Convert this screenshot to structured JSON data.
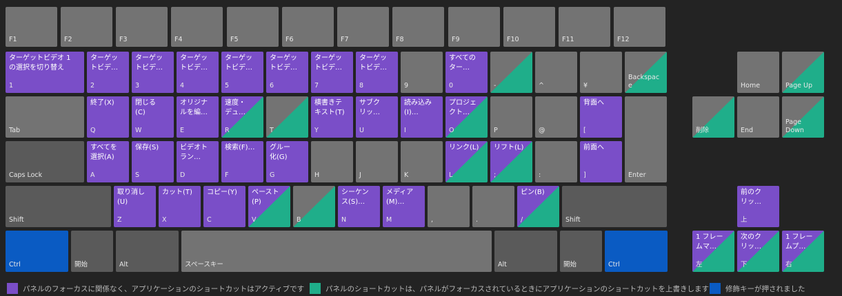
{
  "colors": {
    "background": "#232323",
    "key": "#737373",
    "modifier_key": "#5a5a5a",
    "global_shortcut": "#7a4ec8",
    "panel_shortcut": "#1fae8a",
    "modifier_pressed": "#0a5bc3"
  },
  "keys": [
    {
      "id": "f1",
      "cap": "F1",
      "style": "gray"
    },
    {
      "id": "f2",
      "cap": "F2",
      "style": "gray"
    },
    {
      "id": "f3",
      "cap": "F3",
      "style": "gray"
    },
    {
      "id": "f4",
      "cap": "F4",
      "style": "gray"
    },
    {
      "id": "f5",
      "cap": "F5",
      "style": "gray"
    },
    {
      "id": "f6",
      "cap": "F6",
      "style": "gray"
    },
    {
      "id": "f7",
      "cap": "F7",
      "style": "gray"
    },
    {
      "id": "f8",
      "cap": "F8",
      "style": "gray"
    },
    {
      "id": "f9",
      "cap": "F9",
      "style": "gray"
    },
    {
      "id": "f10",
      "cap": "F10",
      "style": "gray"
    },
    {
      "id": "f11",
      "cap": "F11",
      "style": "gray"
    },
    {
      "id": "f12",
      "cap": "F12",
      "style": "gray"
    },
    {
      "id": "1",
      "cap": "1",
      "action": "ターゲットビデオ 1\nの選択を切り替え",
      "style": "purple"
    },
    {
      "id": "2",
      "cap": "2",
      "action": "ターゲッ\nトビデ…",
      "style": "purple"
    },
    {
      "id": "3",
      "cap": "3",
      "action": "ターゲッ\nトビデ…",
      "style": "purple"
    },
    {
      "id": "4",
      "cap": "4",
      "action": "ターゲッ\nトビデ…",
      "style": "purple"
    },
    {
      "id": "5",
      "cap": "5",
      "action": "ターゲッ\nトビデ…",
      "style": "purple"
    },
    {
      "id": "6",
      "cap": "6",
      "action": "ターゲッ\nトビデ…",
      "style": "purple"
    },
    {
      "id": "7",
      "cap": "7",
      "action": "ターゲッ\nトビデ…",
      "style": "purple"
    },
    {
      "id": "8",
      "cap": "8",
      "action": "ターゲッ\nトビデ…",
      "style": "purple"
    },
    {
      "id": "9",
      "cap": "9",
      "style": "gray"
    },
    {
      "id": "0",
      "cap": "0",
      "action": "すべての\nター…",
      "style": "purple"
    },
    {
      "id": "minus",
      "cap": "-",
      "style": "split"
    },
    {
      "id": "caret",
      "cap": "^",
      "style": "gray"
    },
    {
      "id": "yen",
      "cap": "¥",
      "style": "gray"
    },
    {
      "id": "backspace",
      "cap": "Backspac\ne",
      "style": "split"
    },
    {
      "id": "home",
      "cap": "Home",
      "style": "gray"
    },
    {
      "id": "pageup",
      "cap": "Page Up",
      "style": "split"
    },
    {
      "id": "tab",
      "cap": "Tab",
      "style": "gray"
    },
    {
      "id": "q",
      "cap": "Q",
      "action": "終了(X)",
      "style": "purple"
    },
    {
      "id": "w",
      "cap": "W",
      "action": "閉じる\n(C)",
      "style": "purple"
    },
    {
      "id": "e",
      "cap": "E",
      "action": "オリジナ\nルを編…",
      "style": "purple"
    },
    {
      "id": "r",
      "cap": "R",
      "action": "速度・\nデュ…",
      "style": "psplit"
    },
    {
      "id": "t",
      "cap": "T",
      "style": "split"
    },
    {
      "id": "y",
      "cap": "Y",
      "action": "横書きテ\nキスト(T)",
      "style": "purple"
    },
    {
      "id": "u",
      "cap": "U",
      "action": "サブク\nリッ…",
      "style": "purple"
    },
    {
      "id": "i",
      "cap": "I",
      "action": "読み込み\n(I)…",
      "style": "purple"
    },
    {
      "id": "o",
      "cap": "O",
      "action": "プロジェ\nクト…",
      "style": "psplit"
    },
    {
      "id": "p",
      "cap": "P",
      "style": "gray"
    },
    {
      "id": "at",
      "cap": "@",
      "style": "gray"
    },
    {
      "id": "lbracket",
      "cap": "[",
      "action": "背面へ",
      "style": "purple"
    },
    {
      "id": "enter",
      "cap": "Enter",
      "style": "gray"
    },
    {
      "id": "delete",
      "cap": "削除",
      "style": "split"
    },
    {
      "id": "end",
      "cap": "End",
      "style": "gray"
    },
    {
      "id": "pagedown",
      "cap": "Page\nDown",
      "style": "split"
    },
    {
      "id": "capslock",
      "cap": "Caps Lock",
      "style": "dgray"
    },
    {
      "id": "a",
      "cap": "A",
      "action": "すべてを\n選択(A)",
      "style": "purple"
    },
    {
      "id": "s",
      "cap": "S",
      "action": "保存(S)",
      "style": "purple"
    },
    {
      "id": "d",
      "cap": "D",
      "action": "ビデオト\nラン…",
      "style": "purple"
    },
    {
      "id": "f",
      "cap": "F",
      "action": "検索(F)…",
      "style": "purple"
    },
    {
      "id": "g",
      "cap": "G",
      "action": "グルー\n化(G)",
      "style": "purple"
    },
    {
      "id": "h",
      "cap": "H",
      "style": "gray"
    },
    {
      "id": "j",
      "cap": "J",
      "style": "gray"
    },
    {
      "id": "k",
      "cap": "K",
      "style": "gray"
    },
    {
      "id": "l",
      "cap": "L",
      "action": "リンク(L)",
      "style": "psplit"
    },
    {
      "id": "semicolon",
      "cap": ";",
      "action": "リフト(L)",
      "style": "psplit"
    },
    {
      "id": "colon",
      "cap": ":",
      "style": "gray"
    },
    {
      "id": "rbracket",
      "cap": "]",
      "action": "前面へ",
      "style": "purple"
    },
    {
      "id": "lshift",
      "cap": "Shift",
      "style": "dgray"
    },
    {
      "id": "z",
      "cap": "Z",
      "action": "取り消し\n(U)",
      "style": "purple"
    },
    {
      "id": "x",
      "cap": "X",
      "action": "カット(T)",
      "style": "purple"
    },
    {
      "id": "c",
      "cap": "C",
      "action": "コピー(Y)",
      "style": "purple"
    },
    {
      "id": "v",
      "cap": "V",
      "action": "ペースト\n(P)",
      "style": "psplit"
    },
    {
      "id": "b",
      "cap": "B",
      "style": "split"
    },
    {
      "id": "n",
      "cap": "N",
      "action": "シーケン\nス(S)…",
      "style": "purple"
    },
    {
      "id": "m",
      "cap": "M",
      "action": "メディア\n(M)…",
      "style": "purple"
    },
    {
      "id": "comma",
      "cap": ",",
      "style": "gray"
    },
    {
      "id": "period",
      "cap": ".",
      "style": "gray"
    },
    {
      "id": "slash",
      "cap": "/",
      "action": "ピン(B)",
      "style": "psplit"
    },
    {
      "id": "rshift",
      "cap": "Shift",
      "style": "dgray"
    },
    {
      "id": "arrowup",
      "cap": "上",
      "action": "前のク\nリッ…",
      "style": "purple"
    },
    {
      "id": "lctrl",
      "cap": "Ctrl",
      "style": "blue"
    },
    {
      "id": "lstart",
      "cap": "開始",
      "style": "dgray"
    },
    {
      "id": "lalt",
      "cap": "Alt",
      "style": "dgray"
    },
    {
      "id": "space",
      "cap": "スペースキー",
      "style": "gray"
    },
    {
      "id": "ralt",
      "cap": "Alt",
      "style": "dgray"
    },
    {
      "id": "rstart",
      "cap": "開始",
      "style": "dgray"
    },
    {
      "id": "rctrl",
      "cap": "Ctrl",
      "style": "blue"
    },
    {
      "id": "arrowleft",
      "cap": "左",
      "action": "1 フレー\nムマ…",
      "style": "psplit"
    },
    {
      "id": "arrowdown",
      "cap": "下",
      "action": "次のク\nリッ…",
      "style": "psplit"
    },
    {
      "id": "arrowright",
      "cap": "右",
      "action": "1 フレー\nムプ…",
      "style": "psplit"
    }
  ],
  "legend": [
    {
      "color": "#7a4ec8",
      "text": "パネルのフォーカスに関係なく、アプリケーションのショートカットはアクティブです"
    },
    {
      "color": "#1fae8a",
      "text": "パネルのショートカットは、パネルがフォーカスされているときにアプリケーションのショートカットを上書きします"
    },
    {
      "color": "#0a5bc3",
      "text": "修飾キーが押されました"
    }
  ]
}
